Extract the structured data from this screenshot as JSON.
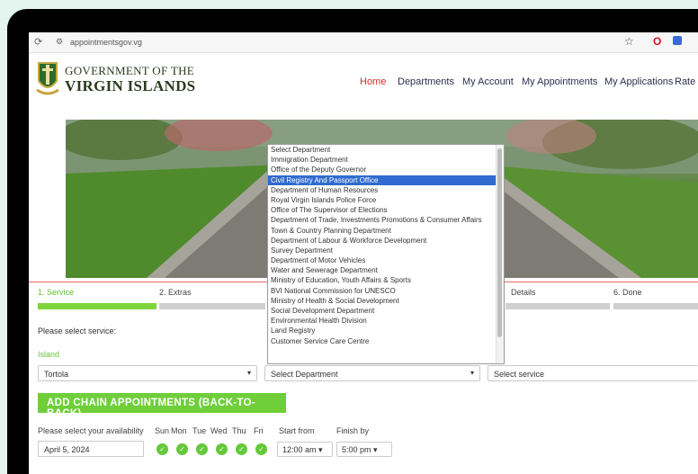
{
  "browser": {
    "url": "appointmentsgov.vg"
  },
  "brand": {
    "line1": "GOVERNMENT OF THE",
    "line2": "VIRGIN ISLANDS"
  },
  "nav": {
    "home": "Home",
    "departments": "Departments",
    "my_account": "My Account",
    "my_appointments": "My Appointments",
    "my_applications": "My Applications",
    "rate": "Rate"
  },
  "steps": {
    "s1": "1. Service",
    "s2": "2. Extras",
    "s5": "Details",
    "s6": "6. Done"
  },
  "service_prompt": "Please select service:",
  "island_label": "Island",
  "selects": {
    "island": "Tortola",
    "department": "Select Department",
    "service": "Select service"
  },
  "chain_button": "ADD CHAIN APPOINTMENTS (BACK-TO-BACK)",
  "availability": {
    "label": "Please select your availability",
    "days": [
      "Sun",
      "Mon",
      "Tue",
      "Wed",
      "Thu",
      "Fri"
    ],
    "start_label": "Start from",
    "finish_label": "Finish by",
    "date": "April 5, 2024",
    "start_time": "12:00 am",
    "finish_time": "5:00 pm"
  },
  "dropdown": {
    "options": [
      "Select Department",
      "Immigration Department",
      "Office of the Deputy Governor",
      "Civil Registry And Passport Office",
      "Department of Human Resources",
      "Royal Virgin Islands Police Force",
      "Office of The Supervisor of Elections",
      "Department of Trade, Investments Promotions & Consumer Affairs",
      "Town & Country Planning Department",
      "Department of Labour & Workforce Development",
      "Survey Department",
      "Department of Motor Vehicles",
      "Water and Sewerage Department",
      "Ministry of Education, Youth Affairs & Sports",
      "BVI National Commission for UNESCO",
      "Ministry of Health & Social Development",
      "Social Development Department",
      "Environmental Health Division",
      "Land Registry",
      "Customer Service Care Centre"
    ],
    "highlighted": "Civil Registry And Passport Office"
  },
  "colors": {
    "accent_green": "#6fce39",
    "nav_active": "#d92d2d",
    "highlight_blue": "#2f6bd0"
  }
}
